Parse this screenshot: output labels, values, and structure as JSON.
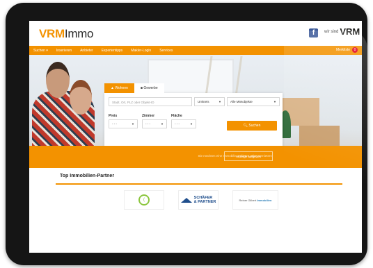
{
  "brand": {
    "vrm": "VRM",
    "immo": "Immo"
  },
  "header": {
    "brand_prefix": "wir sind",
    "brand_name": "VRM",
    "facebook_label": "f"
  },
  "nav": {
    "items": [
      "Suchen ▾",
      "Inserieren",
      "Anbieter",
      "Expertentipps",
      "Makler-Login",
      "Services"
    ],
    "watchlist_label": "Merkliste",
    "watchlist_count": "0"
  },
  "search": {
    "tabs": [
      "Wohnen",
      "Gewerbe"
    ],
    "location_placeholder": "Stadt, Ort, PLZ oder Objekt-ID",
    "radius": "Umkreis",
    "type": "Alle Mietobjekte",
    "price_label": "Preis",
    "rooms_label": "Zimmer",
    "area_label": "Fläche",
    "price_value": "- - -",
    "rooms_value": "- - -",
    "area_value": "- - -",
    "search_button": "Suchen"
  },
  "band": {
    "hint": "Sie möchten eine Immobilie anbieten oder vermieten?",
    "ad_button": "Anzeige aufgeben"
  },
  "partners": {
    "title": "Top Immobilien-Partner",
    "logo2_line1": "SCHÄFER",
    "logo2_line2": "& PARTNER",
    "logo3_text": "Reiner Gilbert",
    "logo3_brand": "Immobilien"
  },
  "colors": {
    "accent": "#f39200",
    "facebook": "#3b5998"
  }
}
